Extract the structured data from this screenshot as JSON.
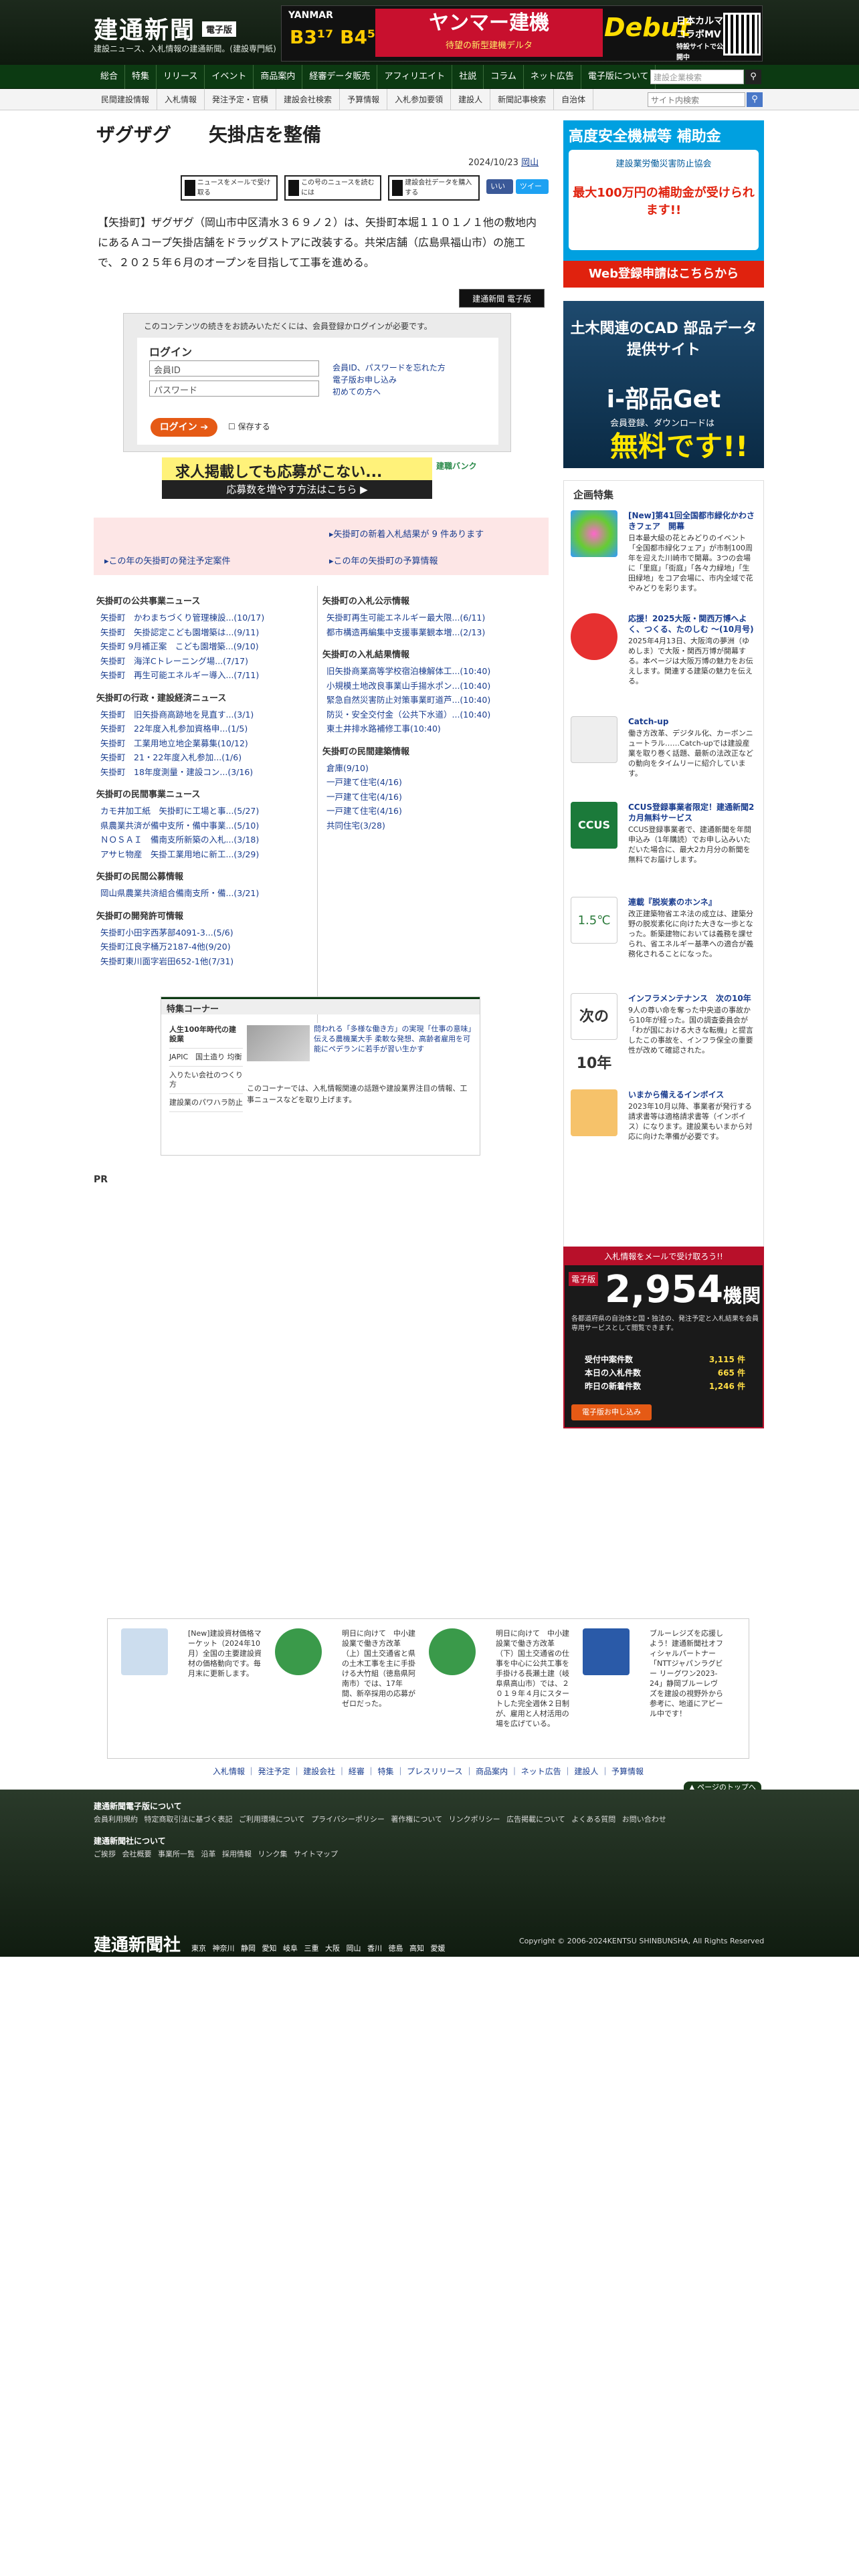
{
  "header": {
    "logo": "建通新聞",
    "badge": "電子版",
    "tagline": "建設ニュース、入札情報の建通新聞。(建設専門紙)",
    "ad": {
      "brand": "YANMAR",
      "model": "B3¹⁷ B4⁵",
      "title": "ヤンマー建機",
      "subtitle": "待望の新型建機デルタ",
      "debut": "Debut",
      "right": "日本カルマ コラボMV",
      "right_sub": "特設サイトで公開中"
    }
  },
  "nav1": {
    "items": [
      "総合",
      "特集",
      "リリース",
      "イベント",
      "商品案内",
      "経審データ販売",
      "アフィリエイト",
      "社説",
      "コラム",
      "ネット広告",
      "電子版について"
    ],
    "search_placeholder": "建設企業検索"
  },
  "nav2": {
    "items": [
      "民間建設情報",
      "入札情報",
      "発注予定・官積",
      "建設会社検索",
      "予算情報",
      "入札参加要領",
      "建設人",
      "新聞記事検索",
      "自治体"
    ],
    "search_placeholder": "サイト内検索"
  },
  "article": {
    "title": "ザグザグ　　矢掛店を整備",
    "date": "2024/10/23",
    "region": "岡山",
    "tools": [
      "ニュースをメールで受け取る",
      "この号のニュースを読むには",
      "建設会社データを購入する"
    ],
    "share": [
      "いいね",
      "ツイート"
    ],
    "body": "【矢掛町】ザグザグ（岡山市中区清水３６９ノ２）は、矢掛町本堀１１０１ノ１他の敷地内にあるＡコープ矢掛店舗をドラッグストアに改装する。共栄店舗（広島県福山市）の施工で、２０２５年６月のオープンを目指して工事を進める。",
    "login_badge": "建通新聞 電子版"
  },
  "login": {
    "note": "このコンテンツの続きをお読みいただくには、会員登録かログインが必要です。",
    "title": "ログイン",
    "id_placeholder": "会員ID",
    "pw_placeholder": "パスワード",
    "forgot": "会員ID、パスワードを忘れた方",
    "apply": "電子版お申し込み",
    "first": "初めての方へ",
    "button": "ログイン",
    "save": "保存する"
  },
  "recruit": {
    "line1": "求人掲載しても応募がこない...",
    "line2": "応募数を増やす方法はこちら ▶",
    "brand": "建職バンク"
  },
  "notice": {
    "a1": "矢掛町の新着入札結果が 9 件あります",
    "a2": "この年の矢掛町の発注予定案件",
    "a3": "この年の矢掛町の予算情報"
  },
  "left_col": [
    {
      "h": "矢掛町の公共事業ニュース",
      "items": [
        "矢掛町　かわまちづくり管理棟設...(10/17)",
        "矢掛町　矢掛認定こども園増築は...(9/11)",
        "矢掛町 9月補正案　こども園増築...(9/10)",
        "矢掛町　海洋Cトレーニング場...(7/17)",
        "矢掛町　再生可能エネルギー導入...(7/11)"
      ]
    },
    {
      "h": "矢掛町の行政・建設経済ニュース",
      "items": [
        "矢掛町　旧矢掛商高跡地を見直す...(3/1)",
        "矢掛町　22年度入札参加資格申...(1/5)",
        "矢掛町　工業用地立地企業募集(10/12)",
        "矢掛町　21・22年度入札参加...(1/6)",
        "矢掛町　18年度測量・建設コン...(3/16)"
      ]
    },
    {
      "h": "矢掛町の民間事業ニュース",
      "items": [
        "カモ井加工紙　矢掛町に工場と事...(5/27)",
        "県農業共済が備中支所・備中事業...(5/10)",
        "ＮＯＳＡＩ　備南支所新築の入札...(3/18)",
        "アサヒ物産　矢掛工業用地に新工...(3/29)"
      ]
    },
    {
      "h": "矢掛町の民間公募情報",
      "items": [
        "岡山県農業共済組合備南支所・備...(3/21)"
      ]
    },
    {
      "h": "矢掛町の開発許可情報",
      "items": [
        "矢掛町小田字西茅部4091-3...(5/6)",
        "矢掛町江良字桶万2187-4他(9/20)",
        "矢掛町東川面字岩田652-1他(7/31)"
      ]
    }
  ],
  "right_col": [
    {
      "h": "矢掛町の入札公示情報",
      "items": [
        "矢掛町再生可能エネルギー最大限...(6/11)",
        "都市構造再編集中支援事業観本増...(2/13)"
      ]
    },
    {
      "h": "矢掛町の入札結果情報",
      "items": [
        "旧矢掛商業高等学校宿泊棟解体工...(10:40)",
        "小規模土地改良事業山手揚水ポン...(10:40)",
        "緊急自然災害防止対策事業町道芦...(10:40)",
        "防災・安全交付金（公共下水道）...(10:40)",
        "東土井排水路補修工事(10:40)"
      ]
    },
    {
      "h": "矢掛町の民間建築情報",
      "items": [
        "倉庫(9/10)",
        "一戸建て住宅(4/16)",
        "一戸建て住宅(4/16)",
        "一戸建て住宅(4/16)",
        "共同住宅(3/28)"
      ]
    }
  ],
  "feature": {
    "title": "特集コーナー",
    "menu": [
      "人生100年時代の建設業",
      "JAPIC　国土造り 均衡",
      "入りたい会社のつくり方",
      "建設業のパワハラ防止"
    ],
    "text": "問われる「多様な働き方」の実現「仕事の意味」伝える農機業大手 柔軟な発想、高齢者雇用を可能にペデランに若手が習い生かす",
    "desc": "このコーナーでは、入札情報関連の話題や建設業界注目の情報、工事ニュースなどを取り上げます。"
  },
  "pr": "PR",
  "side": {
    "ad1": {
      "title": "高度安全機械等 補助金",
      "line1": "建設業労働災害防止協会",
      "line2": "最大100万円の補助金が受けられます!!",
      "cta": "Web登録申請はこちらから"
    },
    "ad2": {
      "title": "土木関連のCAD 部品データ提供サイト",
      "brand": "i-部品Get",
      "note": "会員登録、ダウンロードは",
      "free": "無料です!!"
    },
    "kikaku_title": "企画特集",
    "kikaku": [
      {
        "t": "[New]第41回全国都市緑化かわさきフェア　開幕",
        "d": "日本最大級の花とみどりのイベント「全国都市緑化フェア」が市制100周年を迎えた川崎市で開幕。3つの会場に「里庭」「街庭」「各々力緑地」「生田緑地」をコア会場に、市内全域で花やみどりを彩ります。"
      },
      {
        "t": "応援！2025大阪・関西万博へよく、つくる、たのしむ 〜(10月号)",
        "d": "2025年4月13日、大阪湾の夢洲（ゆめしま）で大阪・関西万博が開幕する。本ページは大阪万博の魅力をお伝えします。関連する建築の魅力を伝える。"
      },
      {
        "t": "Catch-up",
        "d": "働き方改革、デジタル化、カーボンニュートラル……Catch-upでは建設産業を取り巻く話題、最新の法改正などの動向をタイムリーに紹介しています。"
      },
      {
        "t": "CCUS登録事業者限定！建通新聞2カ月無料サービス",
        "d": "CCUS登録事業者で、建通新聞を年間申込み（1年購読）でお申し込みいただいた場合に、最大2カ月分の新聞を無料でお届けします。"
      },
      {
        "t": "連載『脱炭素のホンネ』",
        "d": "改正建築物省エネ法の成立は、建築分野の脱炭素化に向けた大きな一歩となった。新築建物においては義務を課せられ、省エネルギー基準への適合が義務化されることになった。"
      },
      {
        "t": "インフラメンテナンス　次の10年",
        "d": "9人の尊い命を奪った中央道の事故から10年が経った。国の調査委員会が「わが国における大きな転機」と提言したこの事故を、インフラ保全の重要性が改めて確認された。"
      },
      {
        "t": "いまから備えるインボイス",
        "d": "2023年10月以降、事業者が発行する請求書等は適格請求書等（インボイス）になります。建設業もいまから対応に向けた準備が必要です。"
      }
    ],
    "ad3": {
      "header": "入札情報をメールで受け取ろう!!",
      "label": "電子版",
      "count": "2,954",
      "unit": "機関",
      "desc": "各都道府県の自治体と国・独法の、発注予定と入札結果を会員専用サービスとして閲覧できます。",
      "rows": [
        [
          "受付中案件数",
          "3,115 件"
        ],
        [
          "本日の入札件数",
          "665 件"
        ],
        [
          "昨日の新着件数",
          "1,246 件"
        ]
      ],
      "cta": "電子版お申し込み"
    }
  },
  "bottom_strip": [
    {
      "t": "[New]建設資材価格マーケット（2024年10月）全国の主要建設資材の価格動向です。毎月末に更新します。"
    },
    {
      "t": "明日に向けて　中小建設業で働き方改革（上）国土交通省と県の土木工事を主に手掛ける大竹組（徳島県阿南市）では、17年間、新卒採用の応募がゼロだった。"
    },
    {
      "t": "明日に向けて　中小建設業で働き方改革（下）国土交通省の仕事を中心に公共工事を手掛ける長瀬土建（岐阜県高山市）では、２０１９年４月にスタートした完全週休２日制が、雇用と人材活用の場を広げている。"
    },
    {
      "t": "ブルーレジズを応援しよう！建通新聞社オフィシャルパートナー「NTTジャパンラグビー リーグワン2023-24」静岡ブルーレヴズを建設の視野外から参考に、地道にアピール中です！"
    }
  ],
  "bottom_links": "入札情報 ｜ 発注予定 ｜ 建設会社 ｜ 経審 ｜ 特集 ｜ プレスリリース ｜ 商品案内 ｜ ネット広告 ｜ 建設人 ｜ 予算情報",
  "pagetop": "▲ ページのトップへ",
  "footer": {
    "h1": "建通新聞電子版について",
    "l1": "会員利用規約 特定商取引法に基づく表記 ご利用環境について プライバシーポリシー 著作権について リンクポリシー 広告掲載について よくある質問 お問い合わせ",
    "h2": "建通新聞社について",
    "l2": "ご挨拶 会社概要 事業所一覧 沿革 採用情報 リンク集 サイトマップ",
    "logo": "建通新聞社",
    "areas": "東京 神奈川 静岡 愛知 岐阜 三重 大阪 岡山 香川 徳島 高知 愛媛",
    "copyright": "Copyright © 2006-2024KENTSU SHINBUNSHA, All Rights Reserved"
  }
}
